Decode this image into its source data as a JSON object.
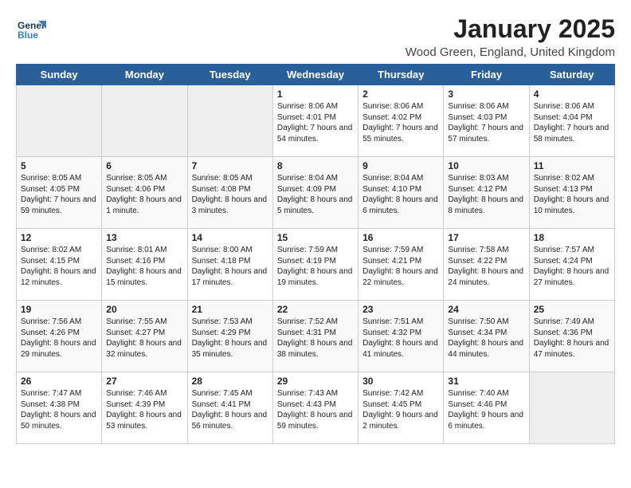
{
  "header": {
    "logo_general": "General",
    "logo_blue": "Blue",
    "title": "January 2025",
    "subtitle": "Wood Green, England, United Kingdom"
  },
  "days_of_week": [
    "Sunday",
    "Monday",
    "Tuesday",
    "Wednesday",
    "Thursday",
    "Friday",
    "Saturday"
  ],
  "weeks": [
    [
      {
        "day": "",
        "info": ""
      },
      {
        "day": "",
        "info": ""
      },
      {
        "day": "",
        "info": ""
      },
      {
        "day": "1",
        "info": "Sunrise: 8:06 AM\nSunset: 4:01 PM\nDaylight: 7 hours\nand 54 minutes."
      },
      {
        "day": "2",
        "info": "Sunrise: 8:06 AM\nSunset: 4:02 PM\nDaylight: 7 hours\nand 55 minutes."
      },
      {
        "day": "3",
        "info": "Sunrise: 8:06 AM\nSunset: 4:03 PM\nDaylight: 7 hours\nand 57 minutes."
      },
      {
        "day": "4",
        "info": "Sunrise: 8:06 AM\nSunset: 4:04 PM\nDaylight: 7 hours\nand 58 minutes."
      }
    ],
    [
      {
        "day": "5",
        "info": "Sunrise: 8:05 AM\nSunset: 4:05 PM\nDaylight: 7 hours\nand 59 minutes."
      },
      {
        "day": "6",
        "info": "Sunrise: 8:05 AM\nSunset: 4:06 PM\nDaylight: 8 hours\nand 1 minute."
      },
      {
        "day": "7",
        "info": "Sunrise: 8:05 AM\nSunset: 4:08 PM\nDaylight: 8 hours\nand 3 minutes."
      },
      {
        "day": "8",
        "info": "Sunrise: 8:04 AM\nSunset: 4:09 PM\nDaylight: 8 hours\nand 5 minutes."
      },
      {
        "day": "9",
        "info": "Sunrise: 8:04 AM\nSunset: 4:10 PM\nDaylight: 8 hours\nand 6 minutes."
      },
      {
        "day": "10",
        "info": "Sunrise: 8:03 AM\nSunset: 4:12 PM\nDaylight: 8 hours\nand 8 minutes."
      },
      {
        "day": "11",
        "info": "Sunrise: 8:02 AM\nSunset: 4:13 PM\nDaylight: 8 hours\nand 10 minutes."
      }
    ],
    [
      {
        "day": "12",
        "info": "Sunrise: 8:02 AM\nSunset: 4:15 PM\nDaylight: 8 hours\nand 12 minutes."
      },
      {
        "day": "13",
        "info": "Sunrise: 8:01 AM\nSunset: 4:16 PM\nDaylight: 8 hours\nand 15 minutes."
      },
      {
        "day": "14",
        "info": "Sunrise: 8:00 AM\nSunset: 4:18 PM\nDaylight: 8 hours\nand 17 minutes."
      },
      {
        "day": "15",
        "info": "Sunrise: 7:59 AM\nSunset: 4:19 PM\nDaylight: 8 hours\nand 19 minutes."
      },
      {
        "day": "16",
        "info": "Sunrise: 7:59 AM\nSunset: 4:21 PM\nDaylight: 8 hours\nand 22 minutes."
      },
      {
        "day": "17",
        "info": "Sunrise: 7:58 AM\nSunset: 4:22 PM\nDaylight: 8 hours\nand 24 minutes."
      },
      {
        "day": "18",
        "info": "Sunrise: 7:57 AM\nSunset: 4:24 PM\nDaylight: 8 hours\nand 27 minutes."
      }
    ],
    [
      {
        "day": "19",
        "info": "Sunrise: 7:56 AM\nSunset: 4:26 PM\nDaylight: 8 hours\nand 29 minutes."
      },
      {
        "day": "20",
        "info": "Sunrise: 7:55 AM\nSunset: 4:27 PM\nDaylight: 8 hours\nand 32 minutes."
      },
      {
        "day": "21",
        "info": "Sunrise: 7:53 AM\nSunset: 4:29 PM\nDaylight: 8 hours\nand 35 minutes."
      },
      {
        "day": "22",
        "info": "Sunrise: 7:52 AM\nSunset: 4:31 PM\nDaylight: 8 hours\nand 38 minutes."
      },
      {
        "day": "23",
        "info": "Sunrise: 7:51 AM\nSunset: 4:32 PM\nDaylight: 8 hours\nand 41 minutes."
      },
      {
        "day": "24",
        "info": "Sunrise: 7:50 AM\nSunset: 4:34 PM\nDaylight: 8 hours\nand 44 minutes."
      },
      {
        "day": "25",
        "info": "Sunrise: 7:49 AM\nSunset: 4:36 PM\nDaylight: 8 hours\nand 47 minutes."
      }
    ],
    [
      {
        "day": "26",
        "info": "Sunrise: 7:47 AM\nSunset: 4:38 PM\nDaylight: 8 hours\nand 50 minutes."
      },
      {
        "day": "27",
        "info": "Sunrise: 7:46 AM\nSunset: 4:39 PM\nDaylight: 8 hours\nand 53 minutes."
      },
      {
        "day": "28",
        "info": "Sunrise: 7:45 AM\nSunset: 4:41 PM\nDaylight: 8 hours\nand 56 minutes."
      },
      {
        "day": "29",
        "info": "Sunrise: 7:43 AM\nSunset: 4:43 PM\nDaylight: 8 hours\nand 59 minutes."
      },
      {
        "day": "30",
        "info": "Sunrise: 7:42 AM\nSunset: 4:45 PM\nDaylight: 9 hours\nand 2 minutes."
      },
      {
        "day": "31",
        "info": "Sunrise: 7:40 AM\nSunset: 4:46 PM\nDaylight: 9 hours\nand 6 minutes."
      },
      {
        "day": "",
        "info": ""
      }
    ]
  ]
}
